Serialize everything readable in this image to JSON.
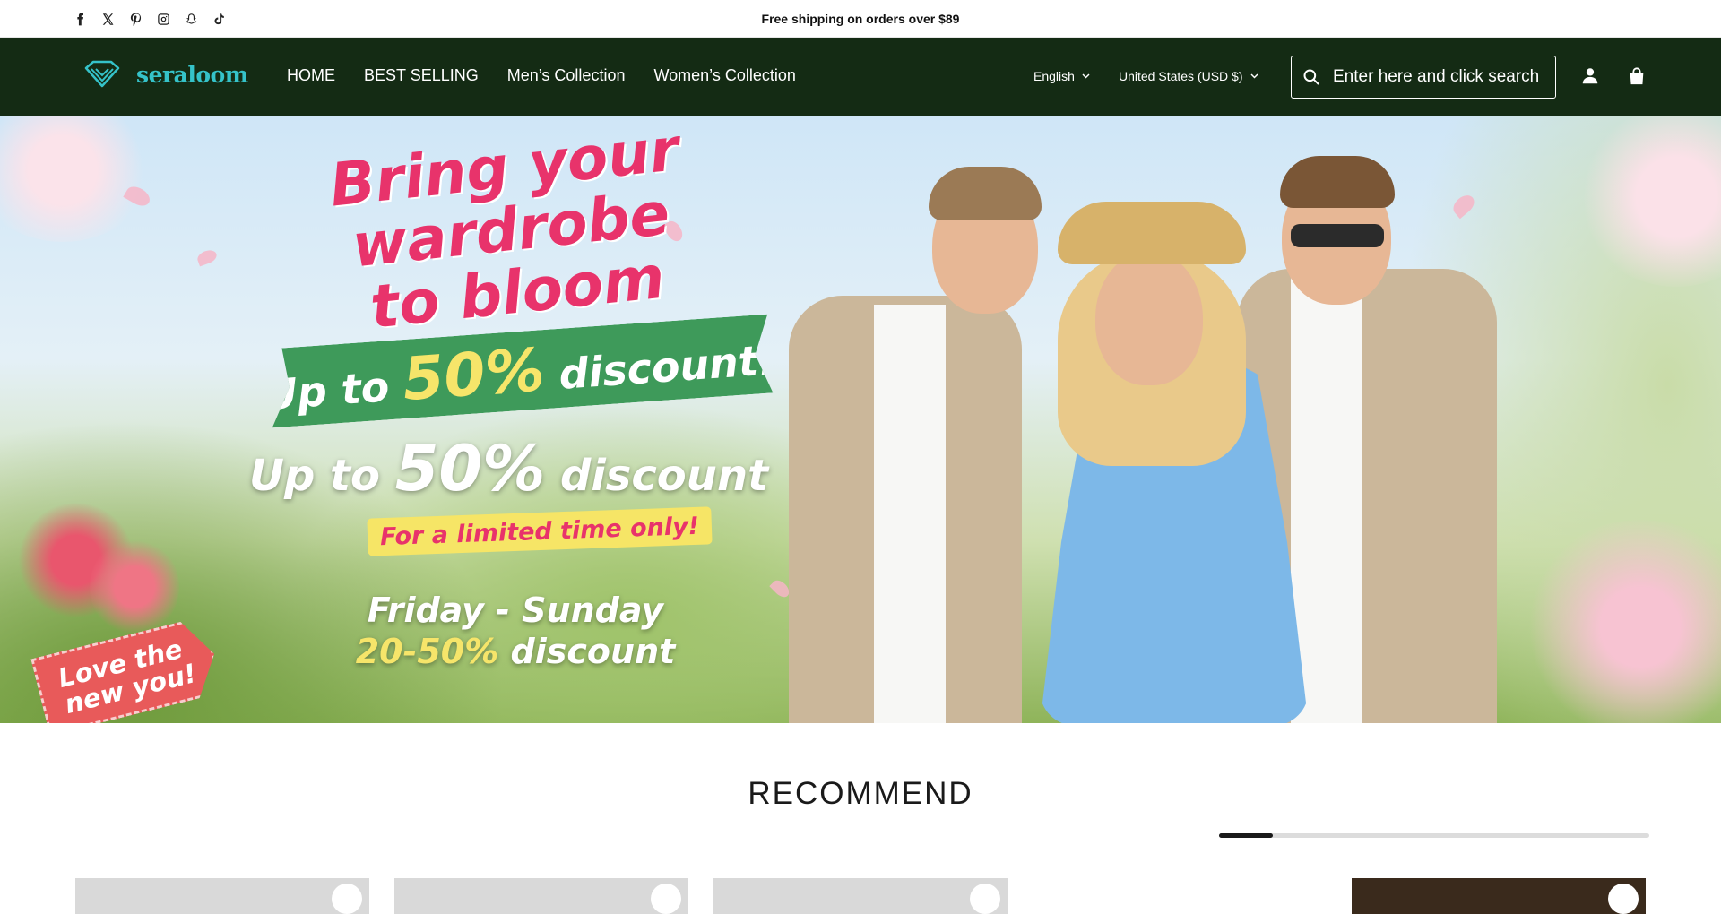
{
  "announcement": {
    "text": "Free shipping on orders over $89",
    "social_icons": [
      "facebook-icon",
      "x-icon",
      "pinterest-icon",
      "instagram-icon",
      "snapchat-icon",
      "tiktok-icon"
    ]
  },
  "header": {
    "brand": "seraloom",
    "nav": [
      "HOME",
      "BEST SELLING",
      "Men’s Collection",
      "Women’s Collection"
    ],
    "language": "English",
    "currency": "United States (USD $)",
    "search_placeholder": "Enter here and click search",
    "colors": {
      "header_bg": "#142b14",
      "brand": "#35c2c9"
    }
  },
  "hero": {
    "headline": "Bring your wardrobe to bloom",
    "ribbon_prefix": "Up to",
    "ribbon_big": "50%",
    "ribbon_suffix": "discount!",
    "line2_prefix": "Up to",
    "line2_big": "50%",
    "line2_suffix": "discount",
    "limited": "For a limited time only!",
    "days_line1": "Friday - Sunday",
    "days_line2_yellow": "20-50%",
    "days_line2_rest": "discount",
    "tag": "Love the new you!"
  },
  "recommend": {
    "title": "RECOMMEND",
    "scroll_progress": 0.125
  }
}
